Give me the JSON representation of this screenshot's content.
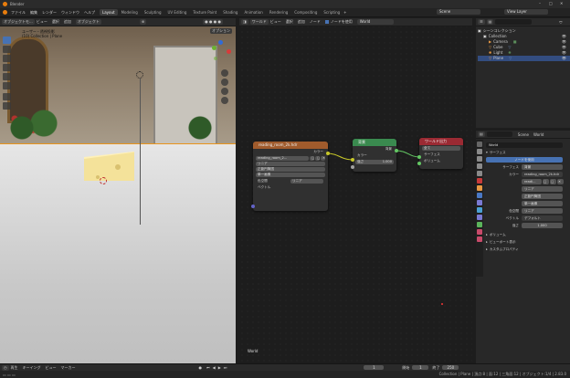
{
  "titlebar": {
    "app": "Blender"
  },
  "menu": [
    "ファイル",
    "編集",
    "レンダー",
    "ウィンドウ",
    "ヘルプ"
  ],
  "workspaces": [
    "Layout",
    "Modeling",
    "Sculpting",
    "UV Editing",
    "Texture Paint",
    "Shading",
    "Animation",
    "Rendering",
    "Compositing",
    "Scripting"
  ],
  "active_workspace": "Layout",
  "scene": {
    "name": "Scene",
    "view_layer": "View Layer"
  },
  "viewport": {
    "mode": "オブジェクトモ...",
    "menus": [
      "ビュー",
      "選択",
      "追加",
      "オブジェクト"
    ],
    "info_line1": "ユーザー・透視投影",
    "info_line2": "(10) Collection | Plane",
    "options": "オプション"
  },
  "node_editor": {
    "header": [
      "ワールド",
      "ビュー",
      "選択",
      "追加",
      "ノード"
    ],
    "use_nodes": "ノードを使用",
    "world": "World",
    "footer_label": "World",
    "nodes": {
      "env": {
        "title": "reading_room_2k.hdr",
        "out": "カラー",
        "image": "reading_room_2...",
        "interp": "リニア",
        "proj": "正距円筒図",
        "ext": "単一画像",
        "colorspace_label": "色空間",
        "colorspace": "リニア",
        "vector": "ベクトル"
      },
      "bg": {
        "title": "背景",
        "out": "背景",
        "color": "カラー",
        "strength_label": "強さ",
        "strength": "1.000"
      },
      "out": {
        "title": "ワールド出力",
        "target": "全て",
        "surface": "サーフェス",
        "volume": "ボリューム"
      }
    }
  },
  "outliner": {
    "items": [
      {
        "label": "シーンコレクション",
        "indent": 0
      },
      {
        "label": "Collection",
        "indent": 1
      },
      {
        "label": "Camera",
        "indent": 2
      },
      {
        "label": "Cube",
        "indent": 2
      },
      {
        "label": "Light",
        "indent": 2
      },
      {
        "label": "Plane",
        "indent": 2,
        "selected": true
      }
    ]
  },
  "properties": {
    "tab_scene": "Scene",
    "tab_world": "World",
    "world_name": "World",
    "surface_section": "サーフェス",
    "use_nodes": "ノードを使用",
    "surface_label": "サーフェス",
    "surface_value": "背景",
    "color_label": "カラー",
    "color_value": "reading_room_2k.hdr",
    "image_value": "readi...",
    "interp": "リニア",
    "proj": "正距円筒図",
    "ext": "単一画像",
    "colorspace_label": "色空間",
    "colorspace_value": "リニア",
    "vector_label": "ベクトル",
    "vector_value": "デフォルト",
    "strength_label": "強さ",
    "strength_value": "1.000",
    "volume": "ボリューム",
    "viewport_display": "ビューポート表示",
    "custom_props": "カスタムプロパティ"
  },
  "timeline": {
    "menus": [
      "再生",
      "キーイング",
      "ビュー",
      "マーカー"
    ],
    "frame": "1",
    "start_label": "開始",
    "start": "1",
    "end_label": "終了",
    "end": "250"
  },
  "status": {
    "right": "Collection | Plane | 頂点:8 | 面:12 | 三角面:12 | オブジェクト:1/4 | 2.83.0"
  },
  "colors": {
    "env_header": "#a05b2c",
    "bg_header": "#3a8a4f",
    "out_header": "#9b2a33",
    "socket_yellow": "#c7c729",
    "socket_gray": "#a1a1a1",
    "socket_green": "#63c763",
    "socket_purple": "#6363c7",
    "selection": "#334d80"
  }
}
